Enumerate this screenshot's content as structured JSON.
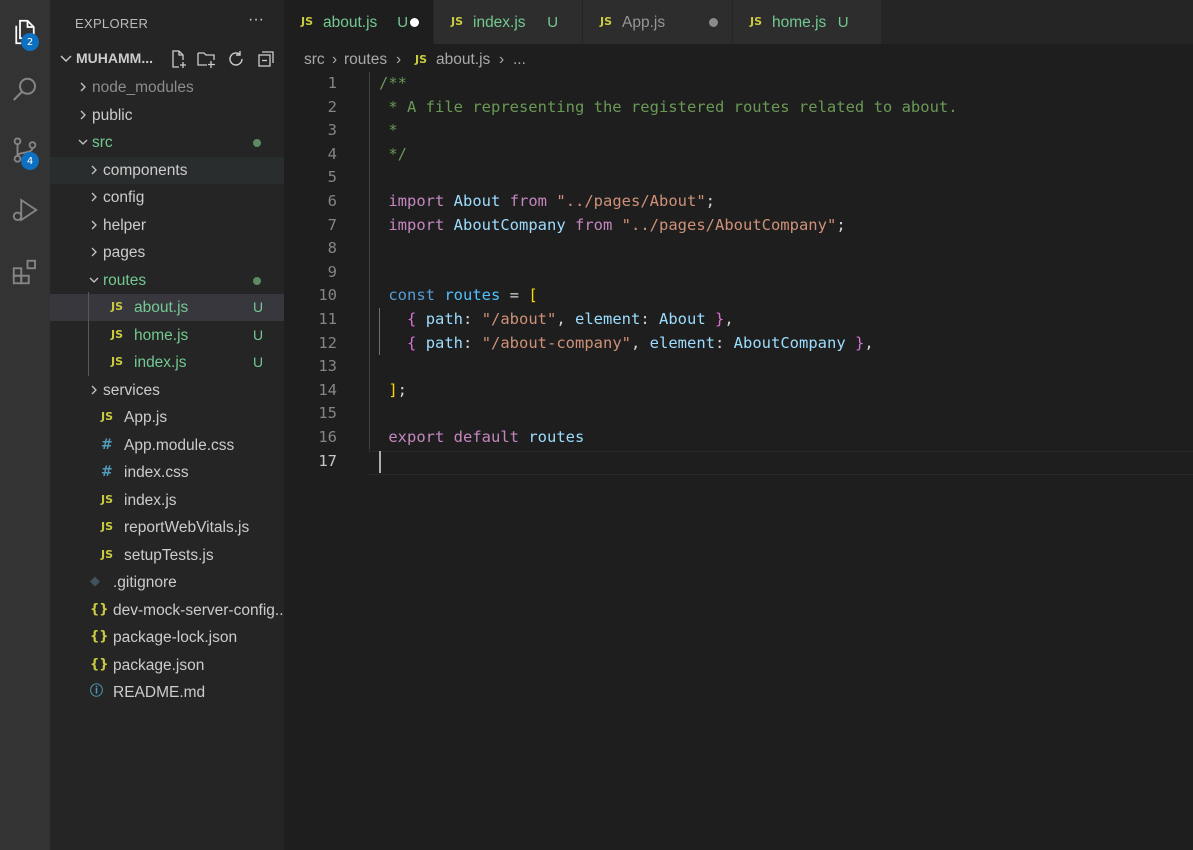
{
  "activity_bar": {
    "explorer_badge": "2",
    "scm_badge": "4"
  },
  "sidebar": {
    "title": "EXPLORER",
    "project_name": "MUHAMM...",
    "tree": [
      {
        "label": "node_modules",
        "kind": "folder",
        "expanded": false,
        "depth": 0,
        "dim": true
      },
      {
        "label": "public",
        "kind": "folder",
        "expanded": false,
        "depth": 0
      },
      {
        "label": "src",
        "kind": "folder",
        "expanded": true,
        "depth": 0,
        "modified_dot": true,
        "green": true
      },
      {
        "label": "components",
        "kind": "folder",
        "expanded": false,
        "depth": 1
      },
      {
        "label": "config",
        "kind": "folder",
        "expanded": false,
        "depth": 1
      },
      {
        "label": "helper",
        "kind": "folder",
        "expanded": false,
        "depth": 1
      },
      {
        "label": "pages",
        "kind": "folder",
        "expanded": false,
        "depth": 1
      },
      {
        "label": "routes",
        "kind": "folder",
        "expanded": true,
        "depth": 1,
        "modified_dot": true,
        "green": true
      },
      {
        "label": "about.js",
        "kind": "js",
        "depth": 2,
        "status": "U",
        "green": true,
        "selected": true
      },
      {
        "label": "home.js",
        "kind": "js",
        "depth": 2,
        "status": "U",
        "green": true
      },
      {
        "label": "index.js",
        "kind": "js",
        "depth": 2,
        "status": "U",
        "green": true
      },
      {
        "label": "services",
        "kind": "folder",
        "expanded": false,
        "depth": 1
      },
      {
        "label": "App.js",
        "kind": "js",
        "depth": 1
      },
      {
        "label": "App.module.css",
        "kind": "css",
        "depth": 1
      },
      {
        "label": "index.css",
        "kind": "css",
        "depth": 1
      },
      {
        "label": "index.js",
        "kind": "js",
        "depth": 1
      },
      {
        "label": "reportWebVitals.js",
        "kind": "js",
        "depth": 1
      },
      {
        "label": "setupTests.js",
        "kind": "js",
        "depth": 1
      },
      {
        "label": ".gitignore",
        "kind": "git",
        "depth": 0
      },
      {
        "label": "dev-mock-server-config....",
        "kind": "json",
        "depth": 0
      },
      {
        "label": "package-lock.json",
        "kind": "json",
        "depth": 0
      },
      {
        "label": "package.json",
        "kind": "json",
        "depth": 0
      },
      {
        "label": "README.md",
        "kind": "info",
        "depth": 0
      }
    ]
  },
  "tabs": [
    {
      "label": "about.js",
      "status": "U",
      "dirty": true,
      "active": true,
      "green": true
    },
    {
      "label": "index.js",
      "status": "U",
      "dirty": false,
      "active": false,
      "green": true
    },
    {
      "label": "App.js",
      "status": "",
      "dirty": true,
      "active": false,
      "green": false
    },
    {
      "label": "home.js",
      "status": "U",
      "dirty": false,
      "active": false,
      "green": true
    }
  ],
  "file_icon_text": "JS",
  "breadcrumb": {
    "parts": [
      "src",
      "routes",
      "about.js",
      "..."
    ]
  },
  "editor": {
    "current_line": 17,
    "lines": [
      [
        {
          "t": "/**",
          "c": "comment"
        }
      ],
      [
        {
          "t": " * A file representing the registered routes related to about.",
          "c": "comment"
        }
      ],
      [
        {
          "t": " *",
          "c": "comment"
        }
      ],
      [
        {
          "t": " */",
          "c": "comment"
        }
      ],
      [],
      [
        {
          "t": " import",
          "c": "keyword"
        },
        {
          "t": " ",
          "c": "plain"
        },
        {
          "t": "About",
          "c": "var"
        },
        {
          "t": " ",
          "c": "plain"
        },
        {
          "t": "from",
          "c": "keyword"
        },
        {
          "t": " ",
          "c": "plain"
        },
        {
          "t": "\"../pages/About\"",
          "c": "string"
        },
        {
          "t": ";",
          "c": "plain"
        }
      ],
      [
        {
          "t": " import",
          "c": "keyword"
        },
        {
          "t": " ",
          "c": "plain"
        },
        {
          "t": "AboutCompany",
          "c": "var"
        },
        {
          "t": " ",
          "c": "plain"
        },
        {
          "t": "from",
          "c": "keyword"
        },
        {
          "t": " ",
          "c": "plain"
        },
        {
          "t": "\"../pages/AboutCompany\"",
          "c": "string"
        },
        {
          "t": ";",
          "c": "plain"
        }
      ],
      [],
      [],
      [
        {
          "t": " const",
          "c": "storage"
        },
        {
          "t": " ",
          "c": "plain"
        },
        {
          "t": "routes",
          "c": "const"
        },
        {
          "t": " = ",
          "c": "plain"
        },
        {
          "t": "[",
          "c": "bracket1"
        }
      ],
      [
        {
          "t": "   ",
          "c": "plain"
        },
        {
          "t": "{",
          "c": "bracket2"
        },
        {
          "t": " ",
          "c": "plain"
        },
        {
          "t": "path",
          "c": "var"
        },
        {
          "t": ": ",
          "c": "plain"
        },
        {
          "t": "\"/about\"",
          "c": "string"
        },
        {
          "t": ", ",
          "c": "plain"
        },
        {
          "t": "element",
          "c": "var"
        },
        {
          "t": ": ",
          "c": "plain"
        },
        {
          "t": "About",
          "c": "var"
        },
        {
          "t": " ",
          "c": "plain"
        },
        {
          "t": "}",
          "c": "bracket2"
        },
        {
          "t": ",",
          "c": "plain"
        }
      ],
      [
        {
          "t": "   ",
          "c": "plain"
        },
        {
          "t": "{",
          "c": "bracket2"
        },
        {
          "t": " ",
          "c": "plain"
        },
        {
          "t": "path",
          "c": "var"
        },
        {
          "t": ": ",
          "c": "plain"
        },
        {
          "t": "\"/about-company\"",
          "c": "string"
        },
        {
          "t": ", ",
          "c": "plain"
        },
        {
          "t": "element",
          "c": "var"
        },
        {
          "t": ": ",
          "c": "plain"
        },
        {
          "t": "AboutCompany",
          "c": "var"
        },
        {
          "t": " ",
          "c": "plain"
        },
        {
          "t": "}",
          "c": "bracket2"
        },
        {
          "t": ",",
          "c": "plain"
        }
      ],
      [],
      [
        {
          "t": " ]",
          "c": "bracket1"
        },
        {
          "t": ";",
          "c": "plain"
        }
      ],
      [],
      [
        {
          "t": " export",
          "c": "keyword"
        },
        {
          "t": " ",
          "c": "plain"
        },
        {
          "t": "default",
          "c": "keyword"
        },
        {
          "t": " ",
          "c": "plain"
        },
        {
          "t": "routes",
          "c": "var"
        }
      ],
      []
    ]
  },
  "colors": {
    "accent": "#0e70c0",
    "untracked_green": "#73c991",
    "js_yellow": "#cbcb41"
  }
}
